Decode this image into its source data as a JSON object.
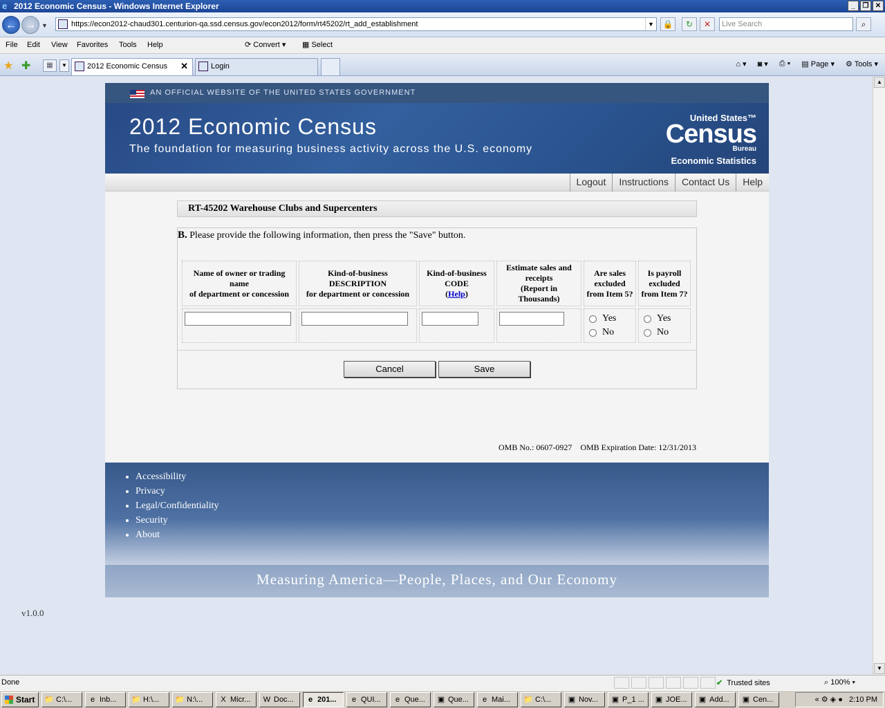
{
  "window": {
    "title": "2012 Economic Census - Windows Internet Explorer"
  },
  "browser": {
    "url": "https://econ2012-chaud301.centurion-qa.ssd.census.gov/econ2012/form/rt45202/rt_add_establishment",
    "search_placeholder": "Live Search",
    "menu": [
      "File",
      "Edit",
      "View",
      "Favorites",
      "Tools",
      "Help"
    ],
    "convert_label": "Convert",
    "select_label": "Select",
    "tabs": [
      {
        "label": "2012 Economic Census"
      },
      {
        "label": "Login"
      }
    ],
    "cmd": {
      "page": "Page",
      "tools": "Tools"
    }
  },
  "site": {
    "gov_banner": "AN OFFICIAL WEBSITE OF THE UNITED STATES GOVERNMENT",
    "title": "2012 Economic Census",
    "subtitle": "The foundation for measuring business activity across the U.S. economy",
    "logo": {
      "us": "United States™",
      "census": "Census",
      "bureau": "Bureau",
      "division": "Economic Statistics"
    },
    "nav": [
      "Logout",
      "Instructions",
      "Contact Us",
      "Help"
    ]
  },
  "form": {
    "title": "RT-45202 Warehouse Clubs and Supercenters",
    "instruction_prefix": "B.",
    "instruction": "Please provide the following information, then press the \"Save\" button.",
    "columns": {
      "owner": [
        "Name of owner or trading name",
        "of department or concession"
      ],
      "kob_desc": [
        "Kind-of-business DESCRIPTION",
        "for department or concession"
      ],
      "kob_code": [
        "Kind-of-business CODE"
      ],
      "kob_help": "Help",
      "sales": [
        "Estimate sales and receipts",
        "(Report in Thousands)"
      ],
      "sales_excluded": [
        "Are sales excluded",
        "from Item 5?"
      ],
      "payroll_excluded": [
        "Is payroll excluded",
        "from Item 7?"
      ]
    },
    "values": {
      "owner": "",
      "kob_desc": "",
      "kob_code": "",
      "sales": ""
    },
    "yes_label": "Yes",
    "no_label": "No",
    "cancel_label": "Cancel",
    "save_label": "Save",
    "omb_no": "OMB No.: 0607-0927",
    "omb_exp": "OMB Expiration Date: 12/31/2013"
  },
  "footer": {
    "links": [
      "Accessibility",
      "Privacy",
      "Legal/Confidentiality",
      "Security",
      "About"
    ],
    "tagline": "Measuring America—People, Places, and Our Economy"
  },
  "version": "v1.0.0",
  "status": {
    "text": "Done",
    "zone": "Trusted sites",
    "zoom": "100%"
  },
  "taskbar": {
    "start": "Start",
    "items": [
      "C:\\...",
      "Inb...",
      "H:\\...",
      "N:\\...",
      "Micr...",
      "Doc...",
      "201...",
      "QUI...",
      "Que...",
      "Que...",
      "Mai...",
      "C:\\...",
      "Nov...",
      "P_1 ...",
      "JOE...",
      "Add...",
      "Cen..."
    ],
    "clock": "2:10 PM"
  }
}
